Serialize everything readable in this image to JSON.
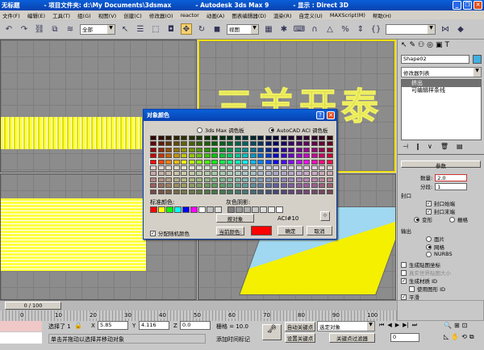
{
  "title_bar": {
    "app_name": "无标题",
    "project_folder": "- 项目文件夹: d:\\My Documents\\3dsmax",
    "app_title": "- Autodesk 3ds Max 9",
    "display": "- 显示 : Direct 3D"
  },
  "menu": [
    "文件(F)",
    "编辑(E)",
    "工具(T)",
    "组(G)",
    "视图(V)",
    "创建(C)",
    "修改器(O)",
    "reactor",
    "动画(A)",
    "图表编辑器(D)",
    "渲染(R)",
    "自定义(U)",
    "MAXScript(M)",
    "帮助(H)"
  ],
  "toolbar": {
    "selection_filter": "全部",
    "coord_system": "视图",
    "named_selection": ""
  },
  "viewport_text": "三羊开泰",
  "command_panel": {
    "object_name": "Shape02",
    "object_color": "#40b0e0",
    "modifier_list": "修改器列表",
    "stack": [
      "挤出",
      "可编辑样条线"
    ],
    "rollout_title": "参数",
    "amount_label": "数量:",
    "amount_value": "2.0",
    "segments_label": "分段:",
    "segments_value": "1",
    "capping_title": "封口",
    "cap_start": "封口始端",
    "cap_end": "封口末端",
    "morph": "变形",
    "grid": "栅格",
    "output_title": "输出",
    "patch": "面片",
    "mesh": "网格",
    "nurbs": "NURBS",
    "gen_map_coords": "生成贴图坐标",
    "real_world_map": "真实世界贴图大小",
    "gen_mat_ids": "生成材质 ID",
    "use_shape_ids": "使用图形 ID",
    "smooth": "平滑"
  },
  "dialog": {
    "title": "对象颜色",
    "palette_3dsmax": "3ds Max 调色板",
    "palette_autocad": "AutoCAD ACI 调色板",
    "standard_colors_label": "标准颜色:",
    "gray_shades_label": "灰色阴影:",
    "by_object": "按对象",
    "aci_label": "ACI#10",
    "assign_random": "分配随机颜色",
    "current_color_label": "当前颜色:",
    "current_color": "#ff0000",
    "ok": "确定",
    "cancel": "取消",
    "standard_colors": [
      "#ff0000",
      "#ffff00",
      "#00ff00",
      "#00ffff",
      "#0000ff",
      "#ff00ff",
      "#ffffff",
      "#c0c0c0",
      "#e0e0e0"
    ],
    "gray_colors": [
      "#808080",
      "#999999",
      "#b0b0b0",
      "#c8c8c8",
      "#dddddd",
      "#eeeeee",
      "#ffffff"
    ]
  },
  "timeline": {
    "frame": "0 / 100",
    "ticks": [
      "0",
      "10",
      "20",
      "30",
      "40",
      "50",
      "60",
      "70",
      "80",
      "90",
      "100"
    ]
  },
  "status": {
    "selected": "选择了 1",
    "x_label": "X",
    "x": "5.85",
    "y_label": "Y",
    "y": "4.116",
    "z_label": "Z",
    "z": "0.0",
    "grid": "栅格 = 10.0",
    "prompt": "单击并拖动以选择并移动对象",
    "add_time_tag": "添加时间标记",
    "auto_key": "自动关键点",
    "set_key": "设置关键点",
    "key_mode": "选定对象",
    "key_filters": "关键点过滤器",
    "current_frame": "0"
  }
}
